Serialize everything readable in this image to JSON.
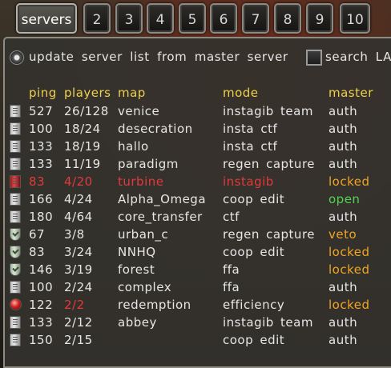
{
  "tabs": [
    "servers",
    "2",
    "3",
    "4",
    "5",
    "6",
    "7",
    "8",
    "9",
    "10"
  ],
  "options": {
    "update_label": "update server list from master server",
    "search_label": "search LA"
  },
  "columns": {
    "ping": "ping",
    "players": "players",
    "map": "map",
    "mode": "mode",
    "master": "master"
  },
  "servers": [
    {
      "icon": "server-icon",
      "ping": "527",
      "players": "26/128",
      "map": "venice",
      "mode": "instagib team",
      "master": "auth",
      "master_color": "normal",
      "row_color": "normal"
    },
    {
      "icon": "server-icon",
      "ping": "100",
      "players": "18/24",
      "map": "desecration",
      "mode": "insta ctf",
      "master": "auth",
      "master_color": "normal",
      "row_color": "normal"
    },
    {
      "icon": "server-icon",
      "ping": "133",
      "players": "18/19",
      "map": "hallo",
      "mode": "insta ctf",
      "master": "auth",
      "master_color": "normal",
      "row_color": "normal"
    },
    {
      "icon": "server-icon",
      "ping": "133",
      "players": "11/19",
      "map": "paradigm",
      "mode": "regen capture",
      "master": "auth",
      "master_color": "normal",
      "row_color": "normal"
    },
    {
      "icon": "lock-icon",
      "ping": "83",
      "players": "4/20",
      "map": "turbine",
      "mode": "instagib",
      "master": "locked",
      "master_color": "orange",
      "row_color": "red"
    },
    {
      "icon": "server-icon",
      "ping": "166",
      "players": "4/24",
      "map": "Alpha_Omega",
      "mode": "coop edit",
      "master": "open",
      "master_color": "green",
      "row_color": "normal"
    },
    {
      "icon": "server-icon",
      "ping": "180",
      "players": "4/64",
      "map": "core_transfer",
      "mode": "ctf",
      "master": "auth",
      "master_color": "normal",
      "row_color": "normal"
    },
    {
      "icon": "shield-icon",
      "ping": "67",
      "players": "3/8",
      "map": "urban_c",
      "mode": "regen capture",
      "master": "veto",
      "master_color": "orange",
      "row_color": "normal"
    },
    {
      "icon": "shield-icon",
      "ping": "83",
      "players": "3/24",
      "map": "NNHQ",
      "mode": "coop edit",
      "master": "locked",
      "master_color": "orange",
      "row_color": "normal"
    },
    {
      "icon": "shield-icon",
      "ping": "146",
      "players": "3/19",
      "map": "forest",
      "mode": "ffa",
      "master": "locked",
      "master_color": "orange",
      "row_color": "normal"
    },
    {
      "icon": "server-icon",
      "ping": "100",
      "players": "2/24",
      "map": "complex",
      "mode": "ffa",
      "master": "auth",
      "master_color": "normal",
      "row_color": "normal"
    },
    {
      "icon": "full-icon",
      "ping": "122",
      "players": "2/2",
      "map": "redemption",
      "mode": "efficiency",
      "master": "locked",
      "master_color": "orange",
      "row_color": "players-red"
    },
    {
      "icon": "server-icon",
      "ping": "133",
      "players": "2/12",
      "map": "abbey",
      "mode": "instagib team",
      "master": "auth",
      "master_color": "normal",
      "row_color": "normal"
    },
    {
      "icon": "server-icon",
      "ping": "150",
      "players": "2/15",
      "map": "",
      "mode": "coop edit",
      "master": "auth",
      "master_color": "normal",
      "row_color": "normal"
    }
  ]
}
